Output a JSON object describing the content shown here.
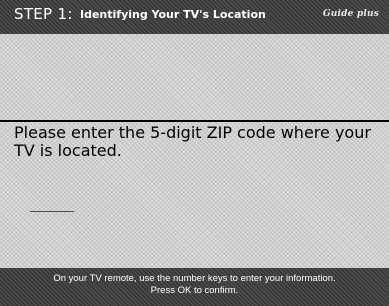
{
  "header": {
    "step": "STEP 1:",
    "title": "Identifying Your TV's Location",
    "logo": "Guide plus"
  },
  "main": {
    "prompt": "Please enter the 5-digit ZIP code where your TV is located.",
    "zip_entry": "_____"
  },
  "footer": {
    "line1": "On your TV remote, use the number keys to enter your information.",
    "line2": "Press OK to confirm."
  }
}
